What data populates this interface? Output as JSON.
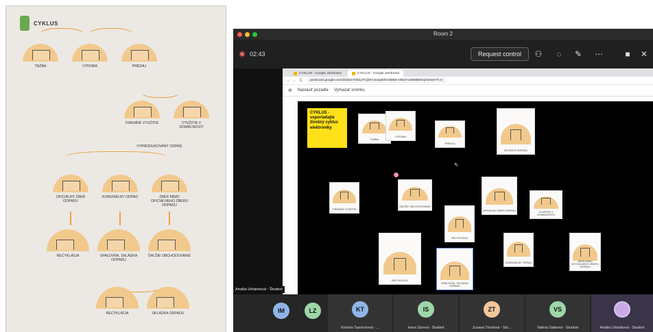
{
  "book": {
    "title": "CYKLUS",
    "nodes": [
      "ŤAŽBA",
      "VÝROBA",
      "PREDAJ",
      "FIREMNÉ VYUŽITIE",
      "VYUŽITIE V DOMÁCNOSTI",
      "VYPRODUKOVANÝ ODPAD",
      "OFICIÁLNY ZBER ODPADU",
      "KOMUNÁLNY ODPAD",
      "ZBER MIMO OFICIÁLNEHO ZBERU ODPADU",
      "RECYKLÁCIA",
      "SPAĽOVŇA, SKLÁDKA ODPADU",
      "ĎALŠIE OBCHODOVANIE",
      "RECYKLÁCIA",
      "SKLÁDKA ODPADU"
    ]
  },
  "call": {
    "window_title": "Room 2",
    "timer": "02:43",
    "request_control": "Request control",
    "presenter_label": "Amália Urbánková - Študent",
    "participants": [
      {
        "initials": "IM",
        "name": "",
        "color": "#8fb5e8"
      },
      {
        "initials": "LZ",
        "name": "",
        "color": "#9ed6a8"
      },
      {
        "initials": "KT",
        "name": "Kristína Tasnochová - ...",
        "color": "#8fb5e8"
      },
      {
        "initials": "IS",
        "name": "Ivona Surová - Študent",
        "color": "#9ed6a8"
      },
      {
        "initials": "ZT",
        "name": "Zuzana Tisoňová - Štu...",
        "color": "#f3c69b"
      },
      {
        "initials": "VS",
        "name": "Valéria Satinová - Študent",
        "color": "#9ed6a8"
      },
      {
        "initials": "",
        "name": "Amália Urbánková - Študent",
        "color": "#c9a9e8"
      }
    ]
  },
  "browser": {
    "tab1": "CYKLUS - Google Jamboard",
    "tab2": "CYKLUS - Google Jamboard",
    "url": "jamboard.google.com/d/1B2v7sE1y7CQkIYJuvqekhVcB8W-nN54YUdN8B0GQ/viewer?f=0",
    "set_background": "Nastaviť pozadie",
    "clear_frame": "Vymazať snímku"
  },
  "jamboard": {
    "sticky": "CYKLUS - usporiadajte životný cyklus elektroniky",
    "cards": [
      "ŤAŽBA",
      "VÝROBA",
      "PREDAJ",
      "SKLÁDKA ODPADU",
      "FIREMNÉ VYUŽITIE",
      "ĎALŠIE OBCHODOVANIE",
      "OFICIÁLNY ZBER ODPADU",
      "VYUŽITIE V DOMÁCNOSTI",
      "RECYKLÁCIA",
      "RECYKLÁCIA",
      "SPAĽOVŇA, SKLÁDKA ODPADU",
      "KOMUNÁLNY ODPAD",
      "ZBER MIMO OFICIÁLNEHO ZBERU ODPADU"
    ]
  },
  "colors": {
    "accent_sticky": "#ffe11a",
    "card_orange": "#f2c98c",
    "arrow_orange": "#e8a33d"
  }
}
